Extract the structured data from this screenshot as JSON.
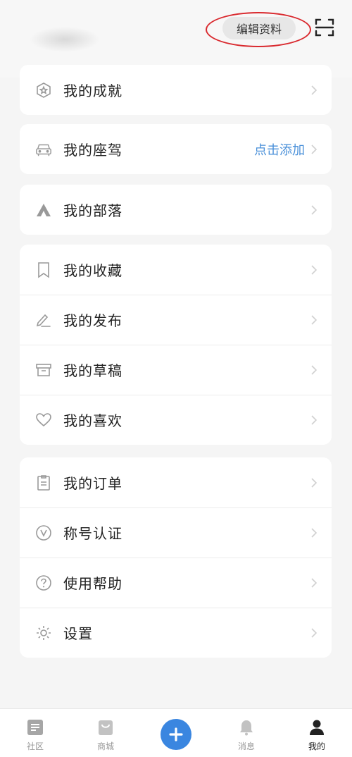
{
  "header": {
    "edit_profile_label": "编辑资料"
  },
  "menu_groups": [
    {
      "items": [
        {
          "label": "我的成就",
          "icon": "badge-icon"
        }
      ]
    },
    {
      "items": [
        {
          "label": "我的座驾",
          "icon": "car-icon",
          "extra": "点击添加"
        }
      ]
    },
    {
      "items": [
        {
          "label": "我的部落",
          "icon": "tribe-icon"
        }
      ]
    },
    {
      "items": [
        {
          "label": "我的收藏",
          "icon": "bookmark-icon"
        },
        {
          "label": "我的发布",
          "icon": "pen-icon"
        },
        {
          "label": "我的草稿",
          "icon": "draft-box-icon"
        },
        {
          "label": "我的喜欢",
          "icon": "heart-icon"
        }
      ]
    },
    {
      "items": [
        {
          "label": "我的订单",
          "icon": "clipboard-icon"
        },
        {
          "label": "称号认证",
          "icon": "verified-v-icon"
        },
        {
          "label": "使用帮助",
          "icon": "question-icon"
        },
        {
          "label": "设置",
          "icon": "gear-icon"
        }
      ]
    }
  ],
  "tabbar": {
    "tabs": [
      {
        "label": "社区",
        "icon": "community-icon"
      },
      {
        "label": "商城",
        "icon": "shop-bag-icon"
      },
      {
        "label": "",
        "icon": "plus-icon"
      },
      {
        "label": "消息",
        "icon": "bell-icon"
      },
      {
        "label": "我的",
        "icon": "user-icon",
        "active": true
      }
    ]
  },
  "colors": {
    "accent_blue": "#3a86e0",
    "link_blue": "#4a90d9",
    "annotation_red": "#d9292e"
  }
}
